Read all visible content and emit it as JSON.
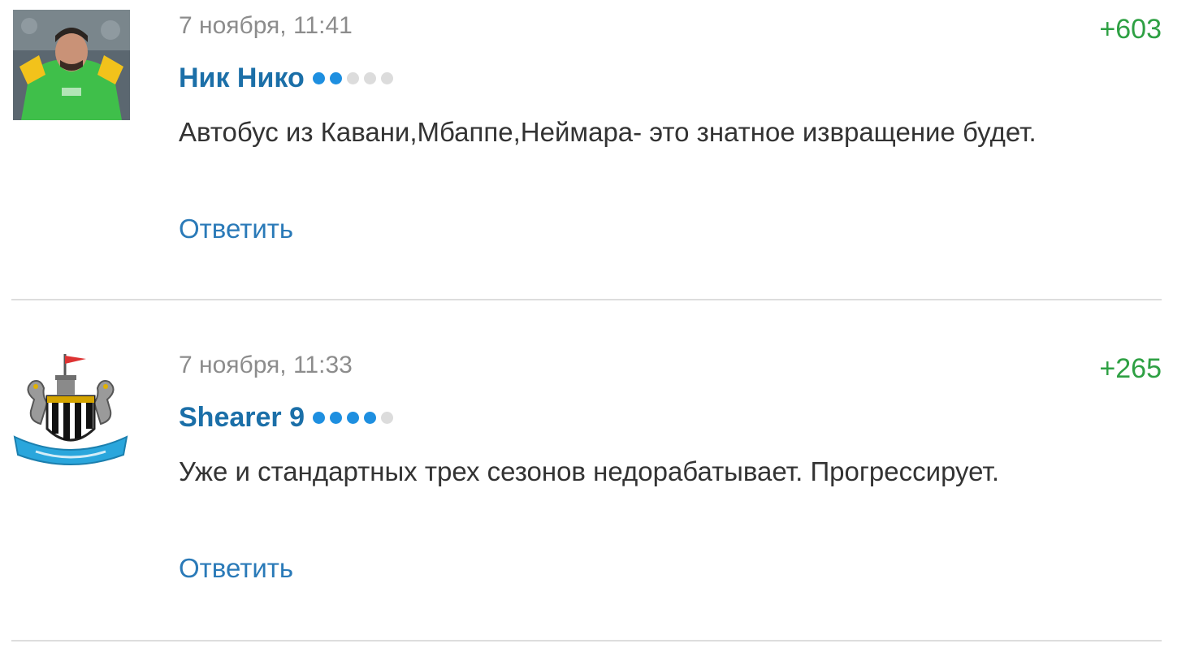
{
  "comments": [
    {
      "date": "7 ноября, 11:41",
      "score": "+603",
      "author": "Ник Нико",
      "rating_level": 2,
      "rating_max": 5,
      "text": "Автобус из Кавани,Мбаппе,Неймара- это знатное извращение будет.",
      "reply_label": "Ответить",
      "avatar_icon": "goalkeeper-photo-avatar"
    },
    {
      "date": "7 ноября, 11:33",
      "score": "+265",
      "author": "Shearer 9",
      "rating_level": 4,
      "rating_max": 5,
      "text": "Уже и стандартных трех сезонов недорабатывает. Прогрессирует.",
      "reply_label": "Ответить",
      "avatar_icon": "newcastle-crest-avatar"
    }
  ],
  "colors": {
    "author": "#1b6fa8",
    "score": "#2ea043",
    "date": "#8c8c8c",
    "reply": "#2a7ab8",
    "rating_on": "#1e8fe0",
    "rating_off": "#dcdcdc"
  }
}
